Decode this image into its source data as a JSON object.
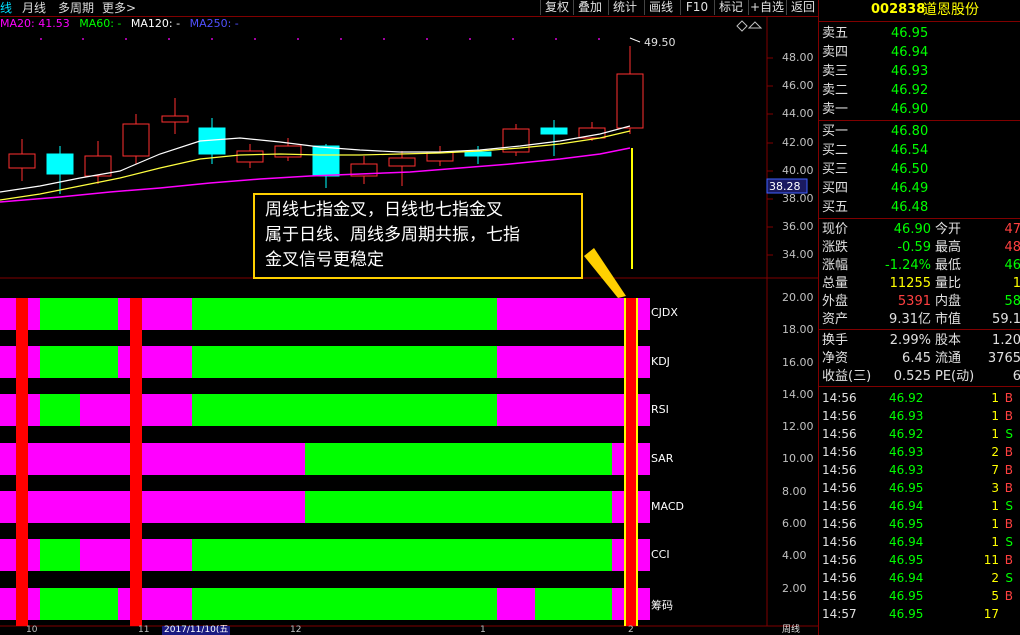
{
  "toolbar": {
    "left_items": [
      "线",
      "月线",
      "多周期",
      "更多>"
    ],
    "buttons": [
      "复权",
      "叠加",
      "统计",
      "画线",
      "F10",
      "标记",
      "+自选",
      "返回"
    ]
  },
  "ma_legend": [
    {
      "label": "MA20: 41.53",
      "color": "#ff00ff"
    },
    {
      "label": "MA60: -",
      "color": "#00ff00"
    },
    {
      "label": "MA120: -",
      "color": "#ffffff"
    },
    {
      "label": "MA250: -",
      "color": "#5050ff"
    }
  ],
  "price_axis": [
    "48.00",
    "46.00",
    "44.00",
    "42.00",
    "40.00",
    "38.00",
    "36.00",
    "34.00"
  ],
  "high_marker": "49.50",
  "current_price_tag": "38.28",
  "indicator_axis": [
    "20.00",
    "18.00",
    "16.00",
    "14.00",
    "12.00",
    "10.00",
    "8.00",
    "6.00",
    "4.00",
    "2.00"
  ],
  "indicators": [
    "CJDX",
    "KDJ",
    "RSI",
    "SAR",
    "MACD",
    "CCI",
    "筹码"
  ],
  "annotation": {
    "lines": [
      "周线七指金叉，日线也七指金叉",
      "属于日线、周线多周期共振，七指",
      "金叉信号更稳定"
    ]
  },
  "date_axis": [
    "10",
    "11",
    "2017/11/10(五",
    "12",
    "1",
    "2"
  ],
  "date_axis_right": "周线",
  "stock": {
    "code": "002838",
    "name": "道恩股份"
  },
  "order_book": {
    "sell": [
      {
        "label": "卖五",
        "price": "46.95"
      },
      {
        "label": "卖四",
        "price": "46.94"
      },
      {
        "label": "卖三",
        "price": "46.93"
      },
      {
        "label": "卖二",
        "price": "46.92"
      },
      {
        "label": "卖一",
        "price": "46.90"
      }
    ],
    "buy": [
      {
        "label": "买一",
        "price": "46.80"
      },
      {
        "label": "买二",
        "price": "46.54"
      },
      {
        "label": "买三",
        "price": "46.50"
      },
      {
        "label": "买四",
        "price": "46.49"
      },
      {
        "label": "买五",
        "price": "46.48"
      }
    ]
  },
  "quote": [
    {
      "l1": "现价",
      "v1": "46.90",
      "c1": "#00ff00",
      "l2": "今开",
      "v2": "47",
      "c2": "#ff4040"
    },
    {
      "l1": "涨跌",
      "v1": "-0.59",
      "c1": "#00ff00",
      "l2": "最高",
      "v2": "48",
      "c2": "#ff4040"
    },
    {
      "l1": "涨幅",
      "v1": "-1.24%",
      "c1": "#00ff00",
      "l2": "最低",
      "v2": "46",
      "c2": "#00ff00"
    },
    {
      "l1": "总量",
      "v1": "11255",
      "c1": "#ffff00",
      "l2": "量比",
      "v2": "1",
      "c2": "#ffff00"
    },
    {
      "l1": "外盘",
      "v1": "5391",
      "c1": "#ff4040",
      "l2": "内盘",
      "v2": "58",
      "c2": "#00ff00"
    },
    {
      "l1": "资产",
      "v1": "9.31亿",
      "c1": "#e0e0e0",
      "l2": "市值",
      "v2": "59.1",
      "c2": "#e0e0e0"
    }
  ],
  "fin": [
    {
      "l1": "换手",
      "v1": "2.99%",
      "l2": "股本",
      "v2": "1.20"
    },
    {
      "l1": "净资",
      "v1": "6.45",
      "l2": "流通",
      "v2": "3765"
    },
    {
      "l1": "收益(三)",
      "v1": "0.525",
      "l2": "PE(动)",
      "v2": "6"
    }
  ],
  "ticks": [
    {
      "time": "14:56",
      "price": "46.92",
      "vol": "1",
      "bs": "B"
    },
    {
      "time": "14:56",
      "price": "46.93",
      "vol": "1",
      "bs": "B"
    },
    {
      "time": "14:56",
      "price": "46.92",
      "vol": "1",
      "bs": "S"
    },
    {
      "time": "14:56",
      "price": "46.93",
      "vol": "2",
      "bs": "B"
    },
    {
      "time": "14:56",
      "price": "46.93",
      "vol": "7",
      "bs": "B"
    },
    {
      "time": "14:56",
      "price": "46.95",
      "vol": "3",
      "bs": "B"
    },
    {
      "time": "14:56",
      "price": "46.94",
      "vol": "1",
      "bs": "S"
    },
    {
      "time": "14:56",
      "price": "46.95",
      "vol": "1",
      "bs": "B"
    },
    {
      "time": "14:56",
      "price": "46.94",
      "vol": "1",
      "bs": "S"
    },
    {
      "time": "14:56",
      "price": "46.95",
      "vol": "11",
      "bs": "B"
    },
    {
      "time": "14:56",
      "price": "46.94",
      "vol": "2",
      "bs": "S"
    },
    {
      "time": "14:56",
      "price": "46.95",
      "vol": "5",
      "bs": "B"
    },
    {
      "time": "14:57",
      "price": "46.95",
      "vol": "17",
      "bs": ""
    }
  ],
  "colors": {
    "up": "#ff3030",
    "down": "#00ffff",
    "buy": "#ff4040",
    "sell": "#00ff00",
    "frame": "#800000"
  }
}
